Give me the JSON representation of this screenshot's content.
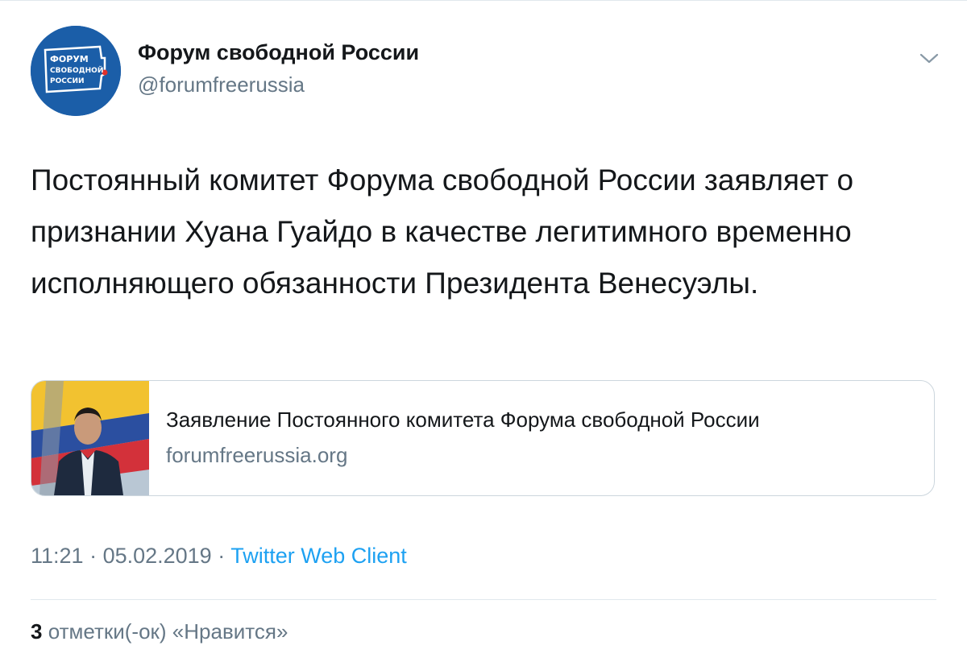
{
  "colors": {
    "avatar_bg": "#1b5ea8",
    "link_blue": "#1da1f2",
    "secondary_text": "#657786",
    "primary_text": "#14171a"
  },
  "author": {
    "display_name": "Форум свободной России",
    "handle": "@forumfreerussia",
    "avatar_logo_lines": [
      "ФОРУМ",
      "СВОБОДНОЙ",
      "РОССИИ"
    ]
  },
  "menu": {
    "icon": "chevron-down-icon"
  },
  "tweet": {
    "text": "Постоянный комитет Форума свободной России заявляет о признании Хуана Гуайдо в качестве легитимного временно исполняющего обязанности Президента Венесуэлы."
  },
  "link_card": {
    "title": "Заявление Постоянного комитета Форума свободной России",
    "domain": "forumfreerussia.org"
  },
  "meta": {
    "time": "11:21",
    "separator": " · ",
    "date": "05.02.2019",
    "separator2": " · ",
    "source": "Twitter Web Client"
  },
  "likes": {
    "count": "3",
    "label": " отметки(-ок) «Нравится»"
  }
}
